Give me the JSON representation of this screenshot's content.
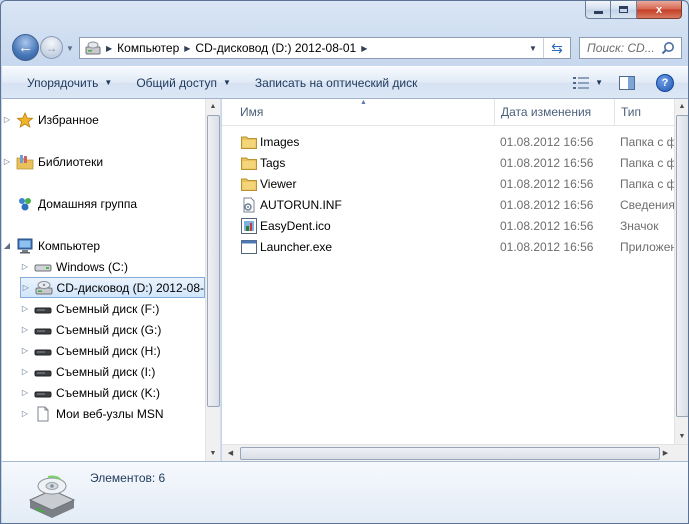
{
  "window": {
    "title_buttons": {
      "minimize": "",
      "maximize": "",
      "close": "x"
    }
  },
  "nav": {
    "breadcrumbs": [
      "Компьютер",
      "CD-дисковод (D:) 2012-08-01"
    ],
    "search_placeholder": "Поиск: CD..."
  },
  "toolbar": {
    "organize": "Упорядочить",
    "share": "Общий доступ",
    "burn": "Записать на оптический диск"
  },
  "navpane": {
    "favorites": "Избранное",
    "libraries": "Библиотеки",
    "homegroup": "Домашняя группа",
    "computer": "Компьютер",
    "drives": [
      {
        "label": "Windows (C:)",
        "icon": "hard-drive-icon"
      },
      {
        "label": "CD-дисковод (D:) 2012-08-",
        "icon": "cd-drive-icon"
      },
      {
        "label": "Съемный диск (F:)",
        "icon": "removable-drive-icon"
      },
      {
        "label": "Съемный диск (G:)",
        "icon": "removable-drive-icon"
      },
      {
        "label": "Съемный диск (H:)",
        "icon": "removable-drive-icon"
      },
      {
        "label": "Съемный диск (I:)",
        "icon": "removable-drive-icon"
      },
      {
        "label": "Съемный диск (K:)",
        "icon": "removable-drive-icon"
      },
      {
        "label": "Мои веб-узлы MSN",
        "icon": "page-icon"
      }
    ]
  },
  "files": {
    "columns": {
      "name": "Имя",
      "date": "Дата изменения",
      "type": "Тип"
    },
    "rows": [
      {
        "name": "Images",
        "date": "01.08.2012 16:56",
        "type": "Папка с фа",
        "icon": "folder-icon"
      },
      {
        "name": "Tags",
        "date": "01.08.2012 16:56",
        "type": "Папка с фа",
        "icon": "folder-icon"
      },
      {
        "name": "Viewer",
        "date": "01.08.2012 16:56",
        "type": "Папка с фа",
        "icon": "folder-icon"
      },
      {
        "name": "AUTORUN.INF",
        "date": "01.08.2012 16:56",
        "type": "Сведения д",
        "icon": "settings-file-icon"
      },
      {
        "name": "EasyDent.ico",
        "date": "01.08.2012 16:56",
        "type": "Значок",
        "icon": "ico-file-icon"
      },
      {
        "name": "Launcher.exe",
        "date": "01.08.2012 16:56",
        "type": "Приложен",
        "icon": "exe-file-icon"
      }
    ]
  },
  "details": {
    "count_text": "Элементов: 6"
  },
  "colors": {
    "accent": "#1e395b",
    "selection": "#d1e6fb",
    "folder": "#e8c15a"
  }
}
